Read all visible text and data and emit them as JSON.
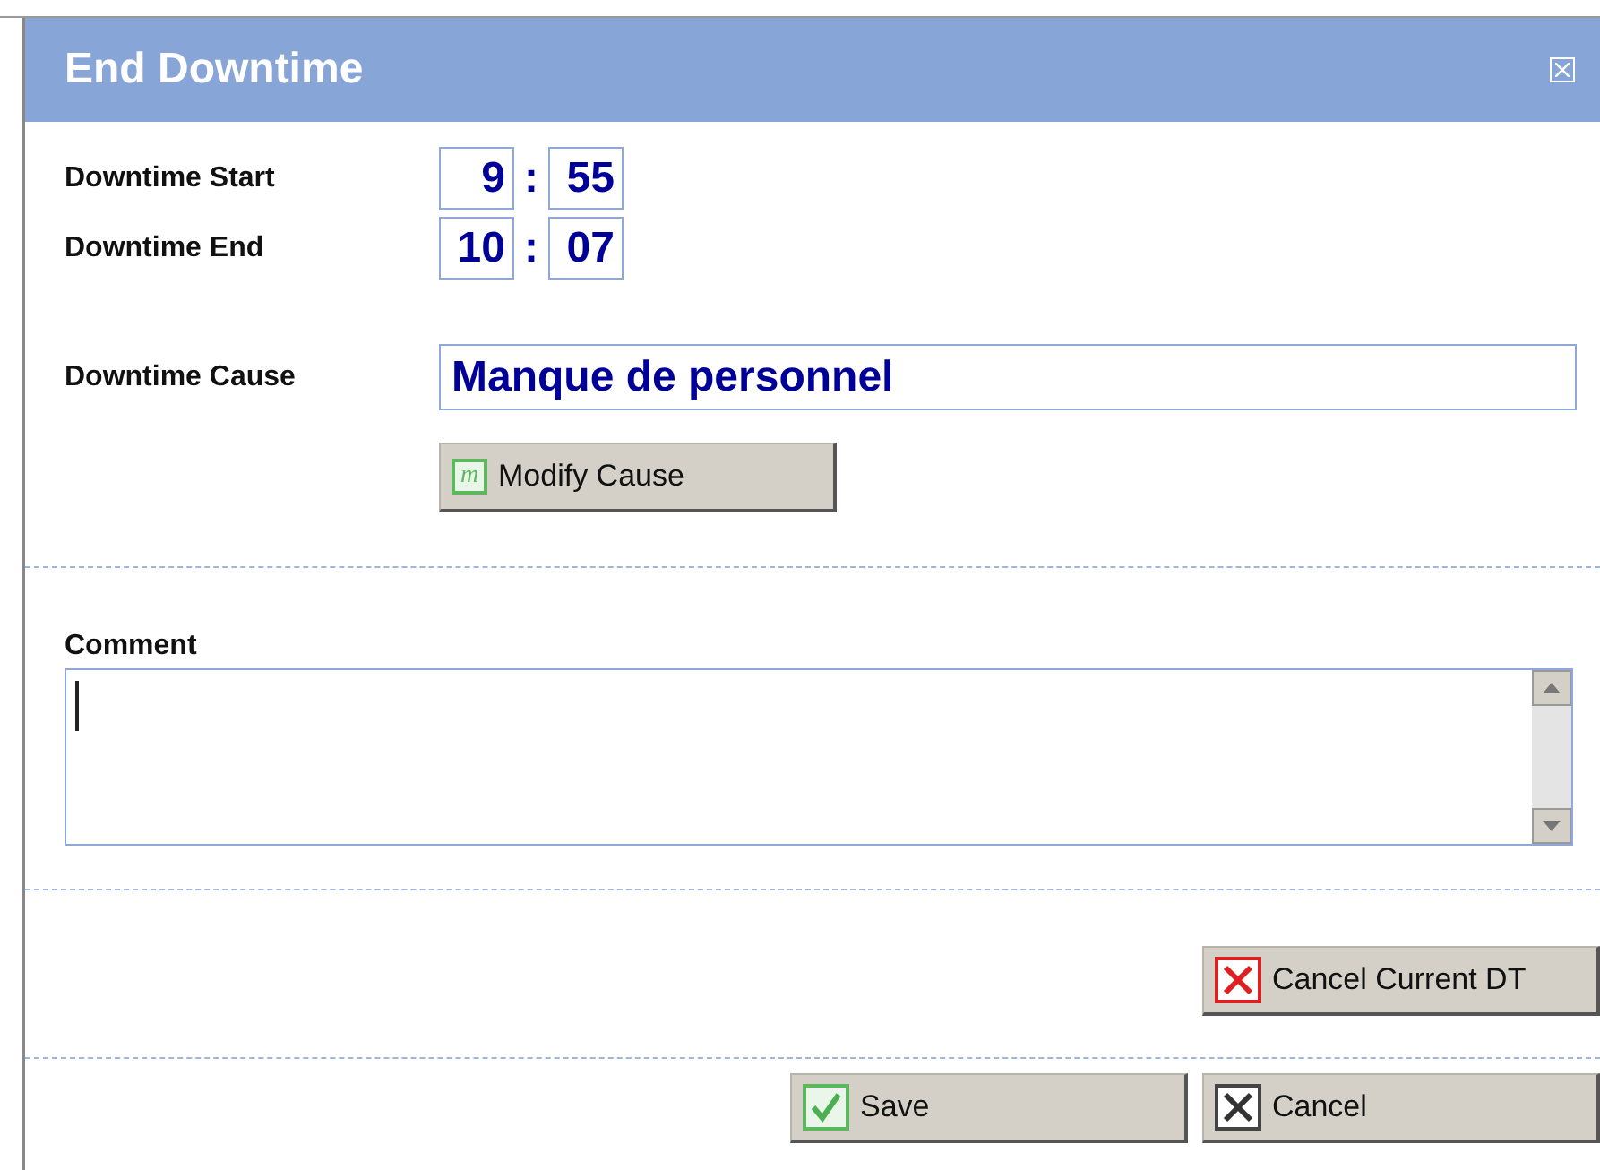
{
  "dialog": {
    "title": "End Downtime"
  },
  "times": [
    {
      "label": "Downtime Start",
      "hours": "9",
      "separator": ":",
      "minutes": "55"
    },
    {
      "label": "Downtime End",
      "hours": "10",
      "separator": ":",
      "minutes": "07"
    }
  ],
  "cause": {
    "label": "Downtime Cause",
    "value": "Manque de personnel",
    "button": {
      "label": "Modify Cause",
      "kind": "modify",
      "icon_letter": "m"
    }
  },
  "comment": {
    "label": "Comment"
  },
  "cancel_current": {
    "label": "Cancel Current DT",
    "kind": "cancel-red"
  },
  "footer_buttons": [
    {
      "label": "Save",
      "kind": "save"
    },
    {
      "label": "Cancel",
      "kind": "cancel"
    }
  ]
}
